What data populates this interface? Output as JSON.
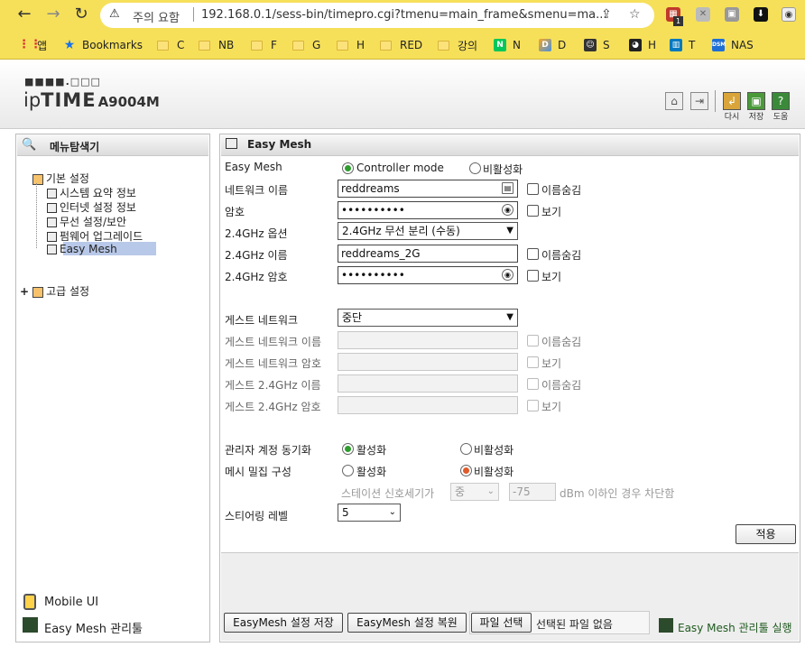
{
  "browser": {
    "security_warning": "주의 요함",
    "url": "192.168.0.1/sess-bin/timepro.cgi?tmenu=main_frame&smenu=ma...",
    "ext_badge": "1",
    "bookmarks": [
      {
        "label": "앱",
        "icon": "apps-grid-icon"
      },
      {
        "label": "Bookmarks",
        "icon": "star-icon"
      },
      {
        "label": "C",
        "icon": "folder-icon"
      },
      {
        "label": "NB",
        "icon": "folder-icon"
      },
      {
        "label": "F",
        "icon": "folder-icon"
      },
      {
        "label": "G",
        "icon": "folder-icon"
      },
      {
        "label": "H",
        "icon": "folder-icon"
      },
      {
        "label": "RED",
        "icon": "folder-icon"
      },
      {
        "label": "강의",
        "icon": "folder-icon"
      },
      {
        "label": "N",
        "icon": "naver-icon"
      },
      {
        "label": "D",
        "icon": "d-icon"
      },
      {
        "label": "S",
        "icon": "s-icon"
      },
      {
        "label": "H",
        "icon": "h-icon"
      },
      {
        "label": "T",
        "icon": "trello-icon"
      },
      {
        "label": "NAS",
        "icon": "dsm-icon"
      }
    ]
  },
  "header": {
    "logo_dots": "■■■■.□□□",
    "logo_ip": "ip",
    "logo_time": "TIME",
    "model": "A9004M",
    "buttons": [
      {
        "label": "다시",
        "icon": "refresh-icon"
      },
      {
        "label": "저장",
        "icon": "save-icon"
      },
      {
        "label": "도움",
        "icon": "help-icon"
      }
    ]
  },
  "sidebar": {
    "title": "메뉴탐색기",
    "basic_group": "기본 설정",
    "basic_items": [
      "시스템 요약 정보",
      "인터넷 설정 정보",
      "무선 설정/보안",
      "펌웨어 업그레이드",
      "Easy Mesh"
    ],
    "advanced_group": "고급 설정",
    "mobile_ui": "Mobile UI",
    "mesh_tool": "Easy Mesh 관리툴"
  },
  "main": {
    "title": "Easy Mesh",
    "easy_mesh_label": "Easy Mesh",
    "easy_mesh_options": [
      "Controller mode",
      "비활성화"
    ],
    "network_name_label": "네트워크 이름",
    "network_name_value": "reddreams",
    "hide_name": "이름숨김",
    "password_label": "암호",
    "password_value": "••••••••••",
    "show": "보기",
    "option_24_label": "2.4GHz 옵션",
    "option_24_value": "2.4GHz 무선 분리 (수동)",
    "name_24_label": "2.4GHz 이름",
    "name_24_value": "reddreams_2G",
    "pw_24_label": "2.4GHz 암호",
    "pw_24_value": "••••••••••",
    "guest_label": "게스트 네트워크",
    "guest_value": "중단",
    "guest_name_label": "게스트 네트워크 이름",
    "guest_pw_label": "게스트 네트워크 암호",
    "guest_name_24_label": "게스트 2.4GHz 이름",
    "guest_pw_24_label": "게스트 2.4GHz 암호",
    "admin_sync_label": "관리자 계정 동기화",
    "admin_sync_on": "활성화",
    "admin_sync_off": "비활성화",
    "mesh_density_label": "메시 밀집 구성",
    "mesh_density_on": "활성화",
    "mesh_density_off": "비활성화",
    "signal_label": "스테이션 신호세기가",
    "signal_level": "중",
    "signal_dbm": "-75",
    "signal_suffix": "dBm 이하인 경우 차단함",
    "steering_label": "스티어링 레벨",
    "steering_value": "5",
    "apply": "적용",
    "save_settings": "EasyMesh 설정 저장",
    "restore_settings": "EasyMesh 설정 복원",
    "choose_file": "파일 선택",
    "no_file": "선택된 파일 없음",
    "run_tool": "Easy Mesh 관리툴 실행"
  }
}
